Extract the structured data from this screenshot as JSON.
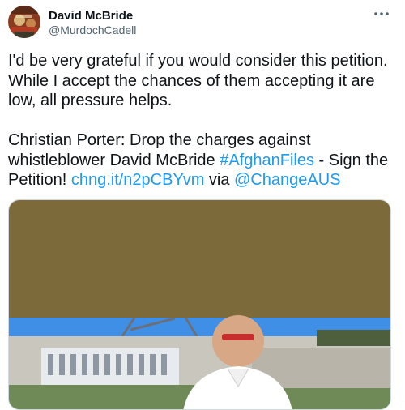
{
  "tweet": {
    "author": {
      "name": "David McBride",
      "handle": "@MurdochCadell"
    },
    "paragraph1": "I'd be very grateful if you would consider this petition. While I accept the chances of them accepting it are low, all pressure helps.",
    "paragraph2": {
      "text_before_hashtag": "Christian Porter: Drop the charges against whistleblower David McBride ",
      "hashtag": "#AfghanFiles",
      "text_after_hashtag": " - Sign the Petition! ",
      "link": "chng.it/n2pCBYvm",
      "text_via": " via ",
      "mention": "@ChangeAUS"
    },
    "media": {
      "banner_color": "#7c6a3a",
      "sky_color": "#3f8fe6"
    }
  },
  "icons": {
    "more": "more-horizontal-icon",
    "avatar": "avatar-image"
  }
}
